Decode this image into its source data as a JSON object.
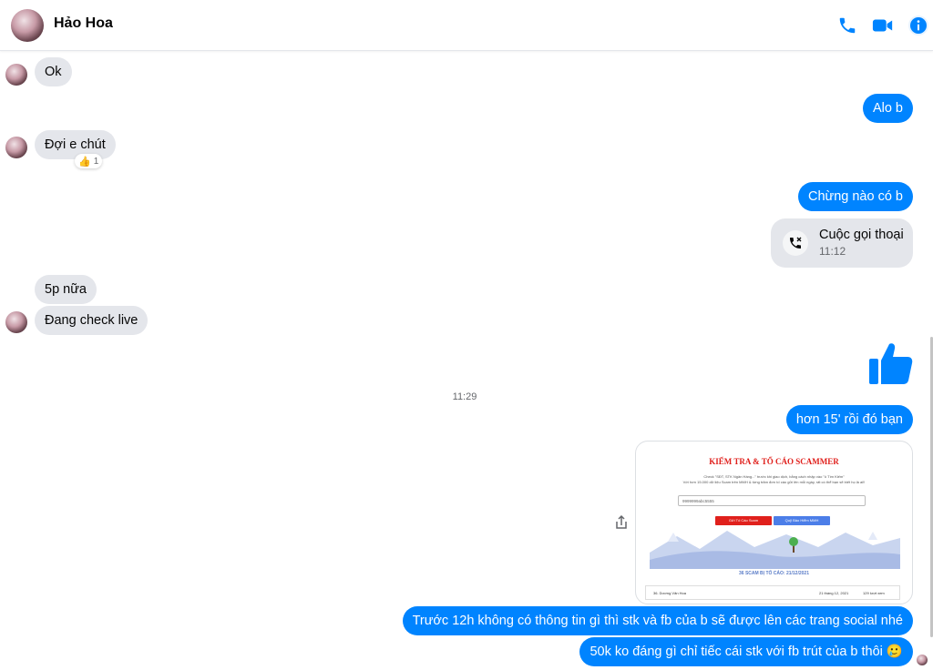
{
  "header": {
    "name": "Hảo Hoa",
    "icons": [
      "phone-icon",
      "video-icon",
      "info-icon"
    ]
  },
  "colors": {
    "accent": "#0084ff",
    "incoming_bubble": "#e4e6eb",
    "text": "#050505",
    "muted": "#65676b"
  },
  "messages": {
    "m1": "Ok",
    "m2": "Alo b",
    "m3": "Đợi e chút",
    "m3_reaction_count": "1",
    "m4": "Chừng nào có b",
    "m6": "5p nữa",
    "m7": "Đang check live",
    "m9": "hơn 15' rồi đó bạn",
    "m11": "Trước 12h không có thông tin gì thì stk và fb của b sẽ được lên các trang social nhé",
    "m12": "50k ko đáng gì chỉ tiếc cái stk với fb trút của b thôi 🥲"
  },
  "call": {
    "title": "Cuộc gọi thoại",
    "time": "11:12"
  },
  "timestamp": "11:29",
  "image_preview": {
    "title": "KIỂM TRA & TỐ CÁO SCAMMER",
    "subtitle_line1": "Check \"SĐT, STK Ngân Hàng...\" trước khi giao dịch, bằng cách nhập vào \"ô Tìm Kiếm\"",
    "subtitle_line2": "Với hơn 15.000 dữ liệu Scam trên MMH & từng trăm đơn tố cáo gửi lên mỗi ngày, rất có thể bạn sẽ biết họ là ai!!",
    "search_value": "9999999abc5555",
    "button_report": "Gửi Tố Cáo Scam",
    "button_middleman": "Quỹ Bảo Hiểm MMH",
    "count_label": "36 SCAM BỊ TỐ CÁO: 21/12/2021",
    "row_name": "36. Dương Văn Hoa",
    "row_date": "21 tháng 12, 2021",
    "row_views": "129 lượt xem"
  }
}
